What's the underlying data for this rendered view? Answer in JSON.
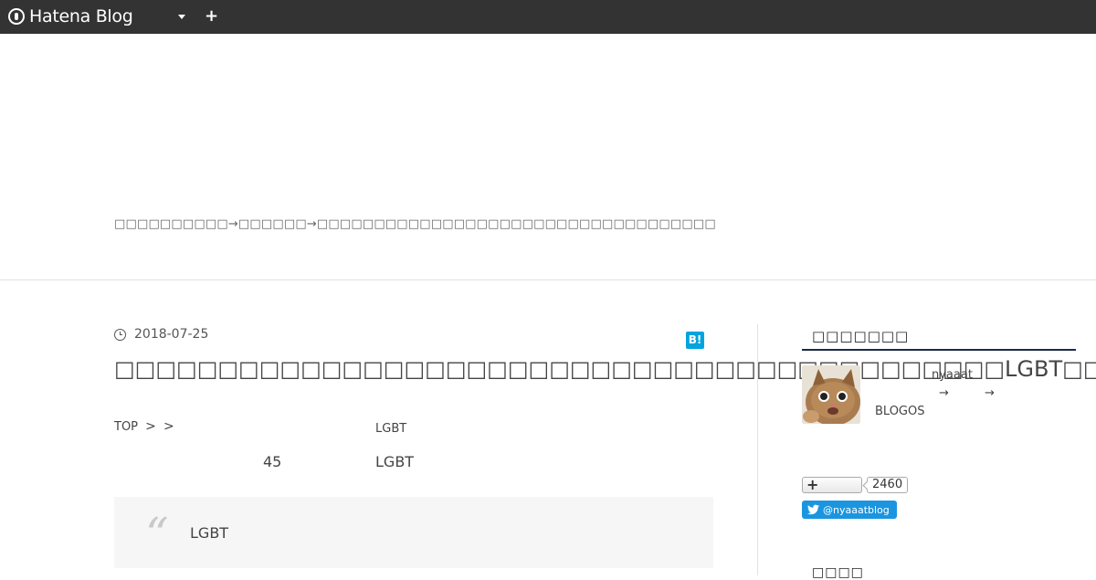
{
  "globalbar": {
    "logo_text": "Hatena Blog",
    "dropdown_icon": "caret-down-icon",
    "add_icon": "plus-icon",
    "add_label": "+"
  },
  "header": {
    "description": "□□□□□□□□□□→□□□□□□→□□□□□□□□□□□□□□□□□□□□□□□□□□□□□□□□□□□"
  },
  "entry": {
    "date": "2018-07-25",
    "hatena_bookmark_label": "B!",
    "title": "□□□□□□□□□□□□□□□□□□□□□□□□□□□□□□□□□□□□□□□□□□□LGBT□□",
    "breadcrumb": {
      "top": "TOP",
      "sep1": ">",
      "sep2": ">",
      "tag": "LGBT"
    },
    "line_text_1": "45",
    "line_text_2": "LGBT",
    "quote_mark": "“",
    "quote_text": "LGBT"
  },
  "sidebar": {
    "profile_heading": "□□□□□□□",
    "author_id": "nyaaat",
    "arrow1": "→",
    "arrow2": "→",
    "blogos": "BLOGOS",
    "subscribe_plus": "+",
    "subscriber_count": "2460",
    "twitter_handle": "@nyaaatblog",
    "next_heading": "□□□□"
  },
  "colors": {
    "globalbar": "#333333",
    "hatena_bookmark": "#00a4de",
    "twitter": "#1b95e0",
    "heading_underline": "#1a2a45"
  }
}
